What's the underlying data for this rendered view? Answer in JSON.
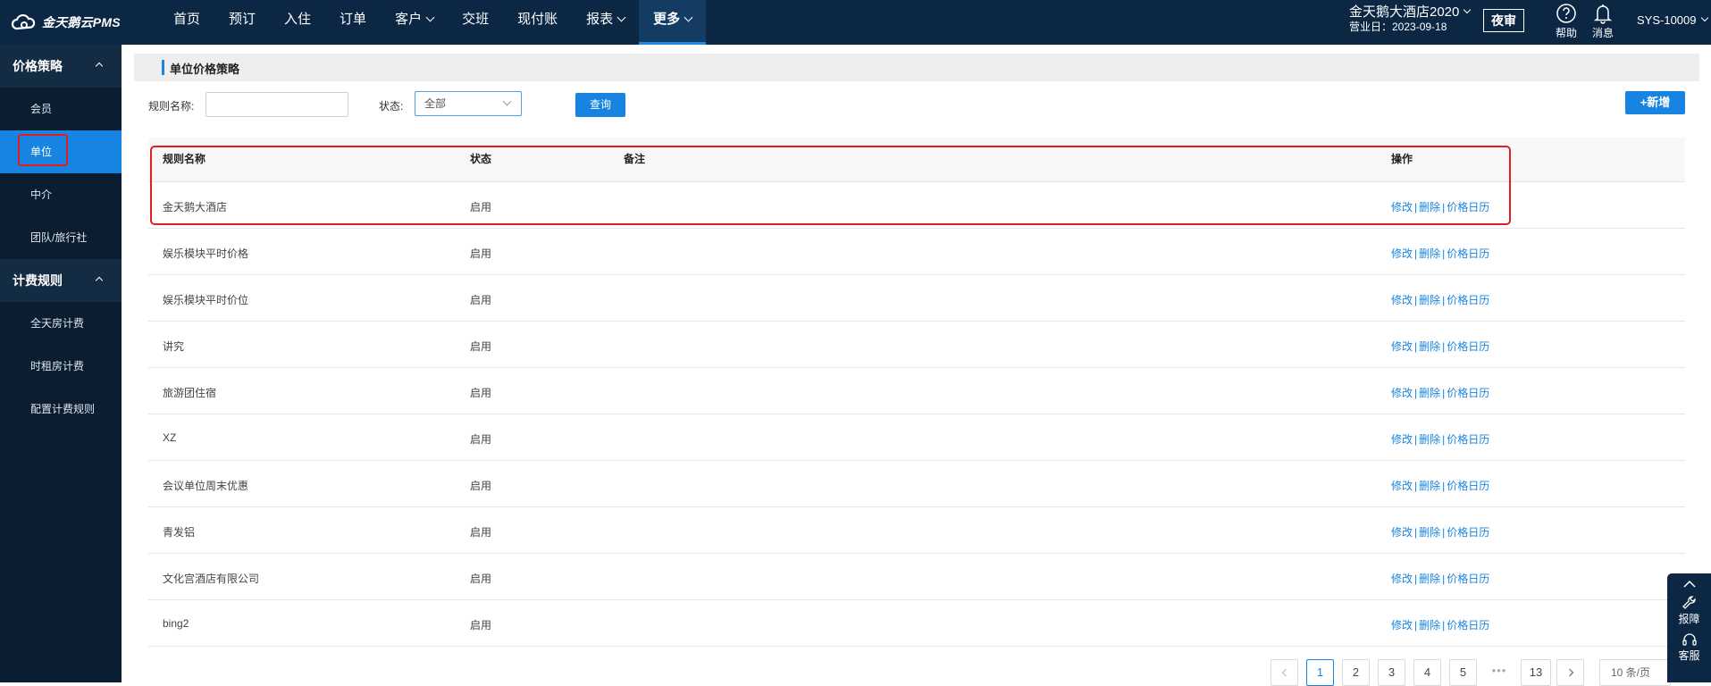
{
  "app": {
    "logo_text": "金天鹅云PMS"
  },
  "nav": {
    "items": [
      {
        "label": "首页",
        "has_dropdown": false
      },
      {
        "label": "预订",
        "has_dropdown": false
      },
      {
        "label": "入住",
        "has_dropdown": false
      },
      {
        "label": "订单",
        "has_dropdown": false
      },
      {
        "label": "客户",
        "has_dropdown": true
      },
      {
        "label": "交班",
        "has_dropdown": false
      },
      {
        "label": "现付账",
        "has_dropdown": false
      },
      {
        "label": "报表",
        "has_dropdown": true
      },
      {
        "label": "更多",
        "has_dropdown": true,
        "active": true
      }
    ]
  },
  "header": {
    "hotel_name": "金天鹅大酒店2020",
    "business_date": "营业日：2023-09-18",
    "night_audit": "夜审",
    "help": "帮助",
    "messages": "消息",
    "user": "SYS-10009"
  },
  "sidebar": {
    "groups": [
      {
        "label": "价格策略",
        "items": [
          "会员",
          "单位",
          "中介",
          "团队/旅行社"
        ],
        "active_item": "单位"
      },
      {
        "label": "计费规则",
        "items": [
          "全天房计费",
          "时租房计费",
          "配置计费规则"
        ]
      }
    ]
  },
  "page": {
    "title": "单位价格策略",
    "filter": {
      "rule_name_label": "规则名称:",
      "rule_name_value": "",
      "status_label": "状态:",
      "status_value": "全部",
      "query_button": "查询"
    },
    "add_button": "+新增"
  },
  "table": {
    "columns": {
      "name": "规则名称",
      "status": "状态",
      "remark": "备注",
      "ops": "操作"
    },
    "rows": [
      {
        "name": "金天鹅大酒店",
        "status": "启用",
        "remark": ""
      },
      {
        "name": "娱乐模块平时价格",
        "status": "启用",
        "remark": ""
      },
      {
        "name": "娱乐模块平时价位",
        "status": "启用",
        "remark": ""
      },
      {
        "name": "讲究",
        "status": "启用",
        "remark": ""
      },
      {
        "name": "旅游团住宿",
        "status": "启用",
        "remark": ""
      },
      {
        "name": "XZ",
        "status": "启用",
        "remark": ""
      },
      {
        "name": "会议单位周末优惠",
        "status": "启用",
        "remark": ""
      },
      {
        "name": "青发铝",
        "status": "启用",
        "remark": ""
      },
      {
        "name": "文化宫酒店有限公司",
        "status": "启用",
        "remark": ""
      },
      {
        "name": "bing2",
        "status": "启用",
        "remark": ""
      }
    ],
    "ops": {
      "edit": "修改",
      "delete": "删除",
      "calendar": "价格日历",
      "sep": "|"
    }
  },
  "pagination": {
    "pages": [
      "1",
      "2",
      "3",
      "4",
      "5"
    ],
    "dots": "•••",
    "last": "13",
    "current": "1",
    "page_size": "10 条/页"
  },
  "float_panel": {
    "report": "报障",
    "service": "客服"
  },
  "colors": {
    "topbar": "#0b2744",
    "sidebar": "#0b1e31",
    "accent": "#1684e0",
    "highlight": "#e02020"
  }
}
